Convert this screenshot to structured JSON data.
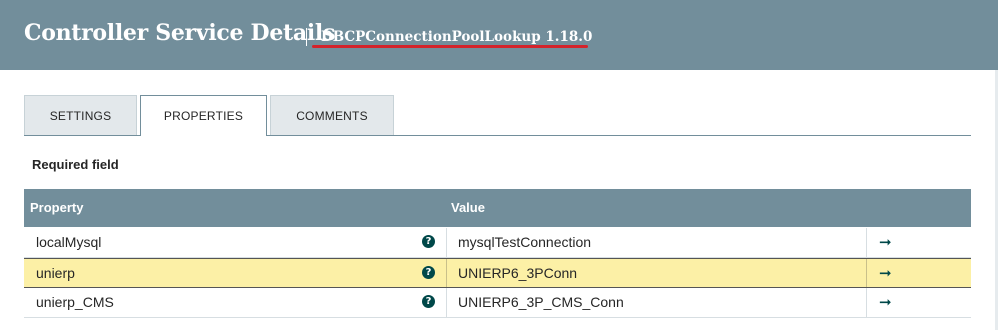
{
  "header": {
    "title": "Controller Service Details",
    "subtitle": "DBCPConnectionPoolLookup 1.18.0"
  },
  "tabs": [
    {
      "label": "SETTINGS",
      "active": false
    },
    {
      "label": "PROPERTIES",
      "active": true
    },
    {
      "label": "COMMENTS",
      "active": false
    }
  ],
  "required_label": "Required field",
  "table": {
    "columns": [
      "Property",
      "Value"
    ],
    "rows": [
      {
        "name": "localMysql",
        "value": "mysqlTestConnection",
        "highlighted": false
      },
      {
        "name": "unierp",
        "value": "UNIERP6_3PConn",
        "highlighted": true
      },
      {
        "name": "unierp_CMS",
        "value": "UNIERP6_3P_CMS_Conn",
        "highlighted": false
      }
    ],
    "help_icon": "question-circle-icon",
    "help_glyph": "?",
    "goto_icon": "arrow-right-icon",
    "goto_glyph": "➞"
  },
  "colors": {
    "header_bg": "#728e9b",
    "highlight_row": "#fcf0a6",
    "annotation": "#d4232b",
    "icon": "#004849"
  }
}
